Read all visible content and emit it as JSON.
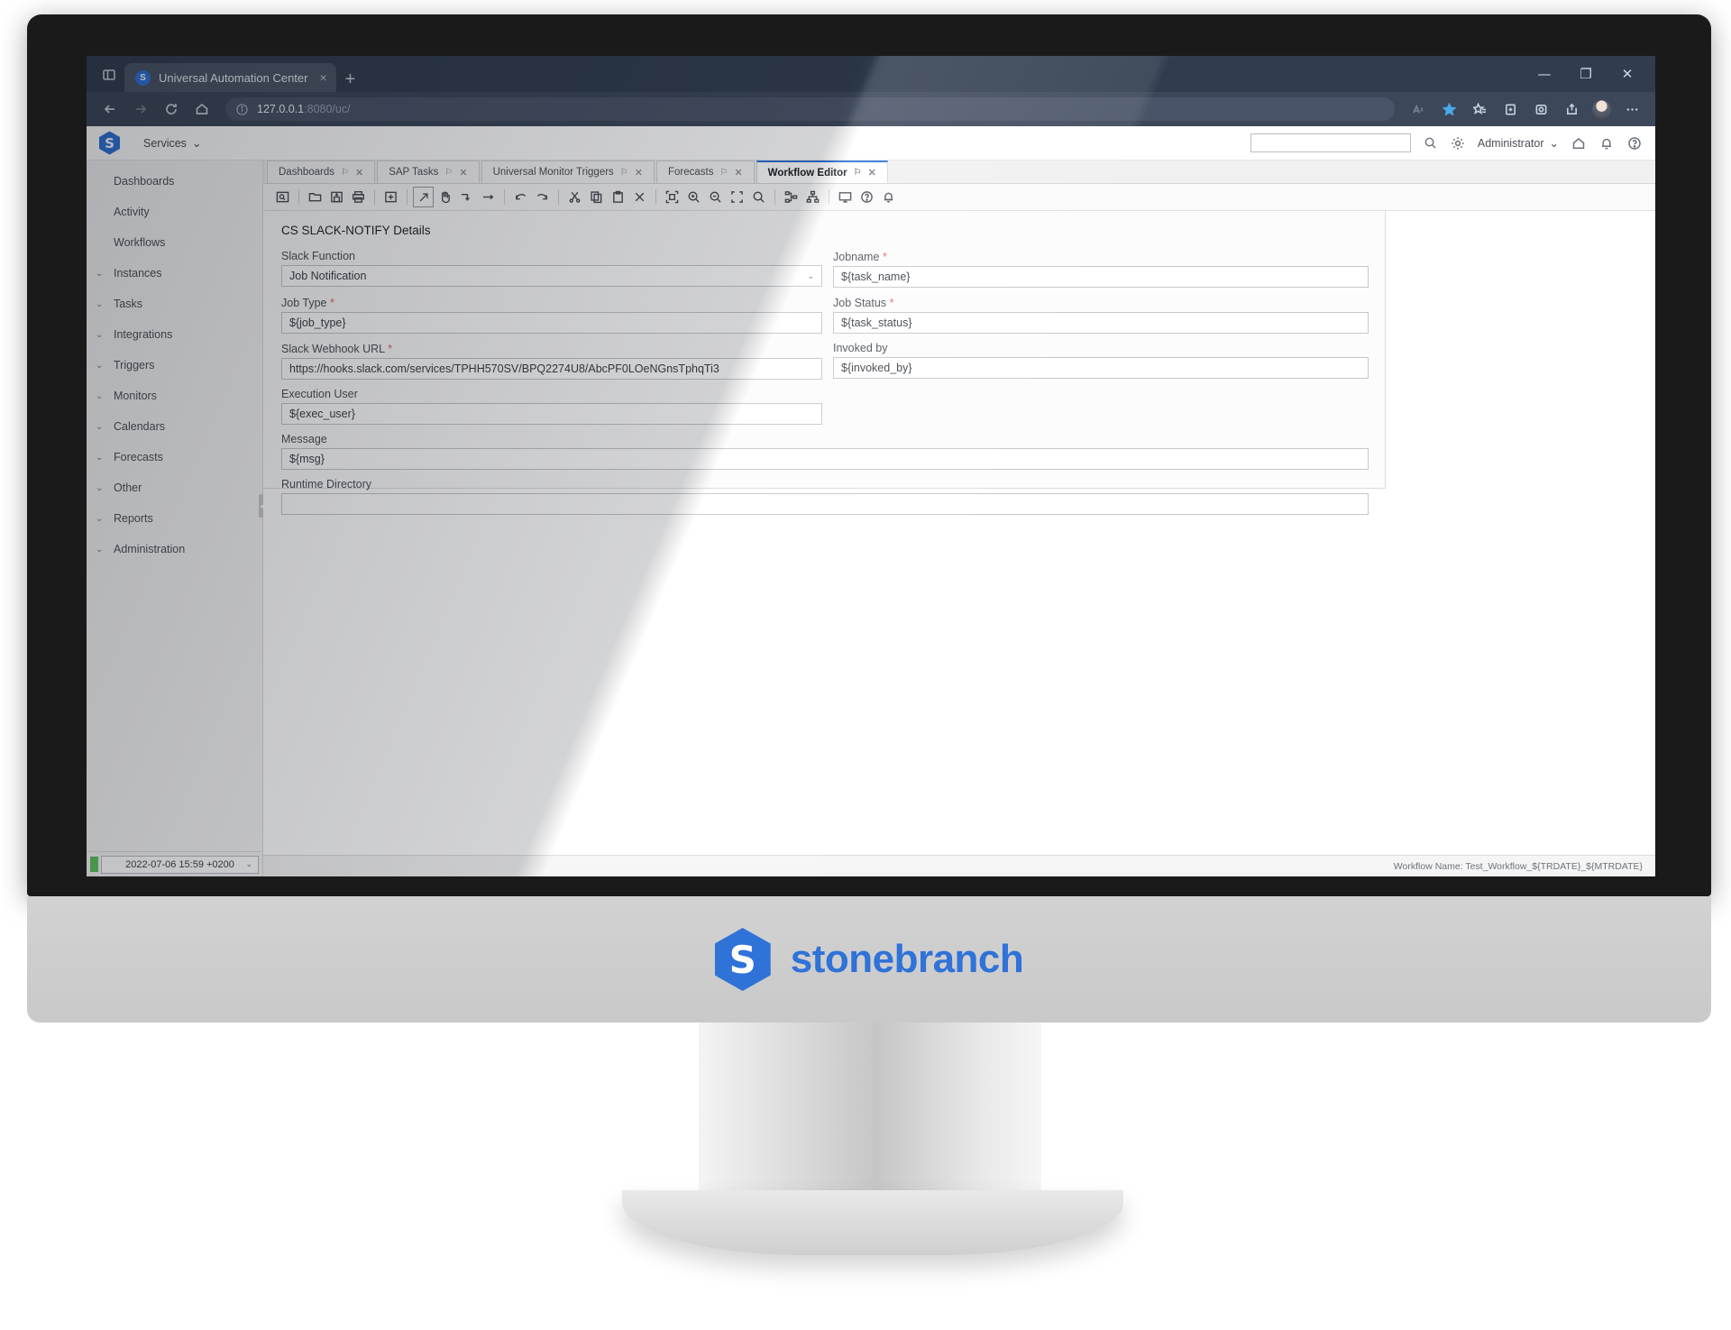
{
  "browser": {
    "tab_title": "Universal Automation Center",
    "tab_favicon_letter": "S",
    "tab_close": "×",
    "new_tab": "+",
    "url_main": "127.0.0.1",
    "url_rest": ":8080/uc/",
    "minimize": "—",
    "maximize": "❐",
    "close": "✕",
    "more": "⋯"
  },
  "app_header": {
    "logo_letter": "S",
    "services_label": "Services",
    "services_chevron": "⌄",
    "search_placeholder": "",
    "user_label": "Administrator",
    "user_chevron": "⌄"
  },
  "sidebar": {
    "items": [
      {
        "label": "Dashboards",
        "expandable": false
      },
      {
        "label": "Activity",
        "expandable": false
      },
      {
        "label": "Workflows",
        "expandable": false
      },
      {
        "label": "Instances",
        "expandable": true
      },
      {
        "label": "Tasks",
        "expandable": true
      },
      {
        "label": "Integrations",
        "expandable": true
      },
      {
        "label": "Triggers",
        "expandable": true
      },
      {
        "label": "Monitors",
        "expandable": true
      },
      {
        "label": "Calendars",
        "expandable": true
      },
      {
        "label": "Forecasts",
        "expandable": true
      },
      {
        "label": "Other",
        "expandable": true
      },
      {
        "label": "Reports",
        "expandable": true
      },
      {
        "label": "Administration",
        "expandable": true
      }
    ],
    "chevron": "⌄",
    "date_value": "2022-07-06 15:59 +0200",
    "date_chevron": "⌄"
  },
  "tabs": [
    {
      "label": "Dashboards",
      "active": false
    },
    {
      "label": "SAP Tasks",
      "active": false
    },
    {
      "label": "Universal Monitor Triggers",
      "active": false
    },
    {
      "label": "Forecasts",
      "active": false
    },
    {
      "label": "Workflow Editor",
      "active": true
    }
  ],
  "tab_glyphs": {
    "pin": "⚐",
    "close": "✕"
  },
  "form": {
    "title": "CS SLACK-NOTIFY Details",
    "fields": [
      {
        "label": "Slack Function",
        "value": "Job Notification",
        "required": false,
        "type": "select",
        "col": "left"
      },
      {
        "label": "Jobname",
        "value": "${task_name}",
        "required": true,
        "type": "text",
        "col": "right"
      },
      {
        "label": "Job Type",
        "value": "${job_type}",
        "required": true,
        "type": "text",
        "col": "left"
      },
      {
        "label": "Job Status",
        "value": "${task_status}",
        "required": true,
        "type": "text",
        "col": "right"
      },
      {
        "label": "Slack Webhook URL",
        "value": "https://hooks.slack.com/services/TPHH570SV/BPQ2274U8/AbcPF0LOeNGnsTphqTi3",
        "required": true,
        "type": "text",
        "col": "left"
      },
      {
        "label": "Invoked by",
        "value": "${invoked_by}",
        "required": false,
        "type": "text",
        "col": "right"
      },
      {
        "label": "Execution User",
        "value": "${exec_user}",
        "required": false,
        "type": "text",
        "col": "left"
      },
      {
        "label": "Message",
        "value": "${msg}",
        "required": false,
        "type": "text",
        "col": "wide"
      },
      {
        "label": "Runtime Directory",
        "value": "",
        "required": false,
        "type": "text",
        "col": "wide"
      }
    ],
    "required_mark": "*"
  },
  "status": {
    "workflow_name": "Workflow Name: Test_Workflow_${TRDATE}_${MTRDATE}"
  },
  "brand": {
    "logo_letter": "S",
    "name": "stonebranch"
  },
  "colors": {
    "accent": "#2f72d8",
    "browser_chrome": "#313d4f",
    "required": "#e06c6c",
    "status_green": "#5bc25b"
  }
}
